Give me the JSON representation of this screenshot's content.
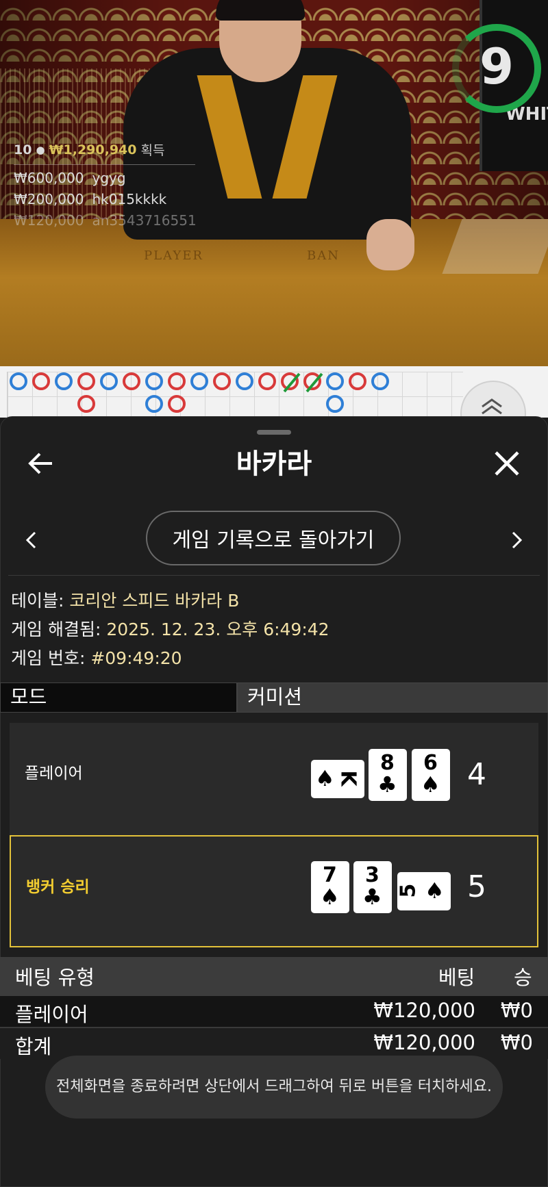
{
  "video": {
    "timer": "9",
    "monitor_text": "WHIT",
    "felt_labels": [
      "PLAYER",
      "BAN"
    ],
    "winners": {
      "count": "10",
      "total": "₩1,290,940",
      "label": "획득",
      "rows": [
        {
          "amount": "₩600,000",
          "user": "ygyg"
        },
        {
          "amount": "₩200,000",
          "user": "hk015kkkk"
        },
        {
          "amount": "₩120,000",
          "user": "an3543716551"
        }
      ]
    }
  },
  "road": {
    "beads": [
      "B",
      "R",
      "B",
      "R",
      "B",
      "R",
      "B",
      "R",
      "B",
      "R",
      "B",
      "R",
      "R",
      "R",
      "B",
      "R",
      "B"
    ],
    "lower_beads": [
      {
        "col": 3,
        "color": "R"
      },
      {
        "col": 6,
        "color": "B"
      },
      {
        "col": 7,
        "color": "R"
      },
      {
        "col": 14,
        "color": "B"
      }
    ]
  },
  "sheet": {
    "title": "바카라",
    "history_button": "게임 기록으로 돌아가기",
    "info": {
      "table_label": "테이블:",
      "table_value": "코리안 스피드 바카라 B",
      "resolved_label": "게임 해결됨:",
      "resolved_value": "2025. 12. 23. 오후 6:49:42",
      "number_label": "게임 번호:",
      "number_value": "#09:49:20"
    },
    "mode_label": "모드",
    "mode_value": "커미션",
    "player": {
      "label": "플레이어",
      "score": "4",
      "cards": [
        {
          "rank": "K",
          "suit": "♠",
          "orientation": "side"
        },
        {
          "rank": "8",
          "suit": "♣",
          "orientation": "up"
        },
        {
          "rank": "6",
          "suit": "♠",
          "orientation": "up"
        }
      ]
    },
    "banker": {
      "label": "뱅커 승리",
      "score": "5",
      "cards": [
        {
          "rank": "7",
          "suit": "♠",
          "orientation": "up"
        },
        {
          "rank": "3",
          "suit": "♣",
          "orientation": "up"
        },
        {
          "rank": "5",
          "suit": "♠",
          "orientation": "side"
        }
      ]
    },
    "bets": {
      "headers": {
        "type": "베팅 유형",
        "bet": "베팅",
        "win": "승"
      },
      "rows": [
        {
          "type": "플레이어",
          "bet": "₩120,000",
          "win": "₩0"
        }
      ],
      "total": {
        "type": "합계",
        "bet": "₩120,000",
        "win": "₩0"
      }
    },
    "toast": "전체화면을 종료하려면 상단에서 드래그하여 뒤로 버튼을 터치하세요."
  }
}
